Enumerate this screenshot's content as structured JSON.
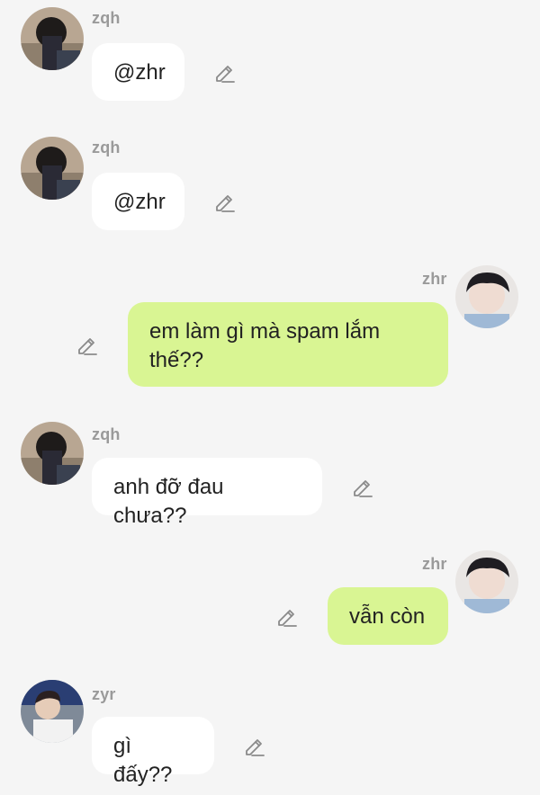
{
  "messages": [
    {
      "sender": "zqh",
      "text": "@zhr"
    },
    {
      "sender": "zqh",
      "text": "@zhr"
    },
    {
      "sender": "zhr",
      "text": "em làm gì mà spam lắm thế??"
    },
    {
      "sender": "zqh",
      "text": "anh đỡ đau chưa??"
    },
    {
      "sender": "zhr",
      "text": "vẫn còn"
    },
    {
      "sender": "zyr",
      "text": "gì đấy??"
    }
  ],
  "icons": {
    "edit": "pencil-edit-icon"
  },
  "colors": {
    "background": "#f5f5f5",
    "incoming_bubble": "#ffffff",
    "outgoing_bubble": "#d9f593",
    "sender_name": "#9a9a9a",
    "icon_stroke": "#8a8a8a"
  }
}
